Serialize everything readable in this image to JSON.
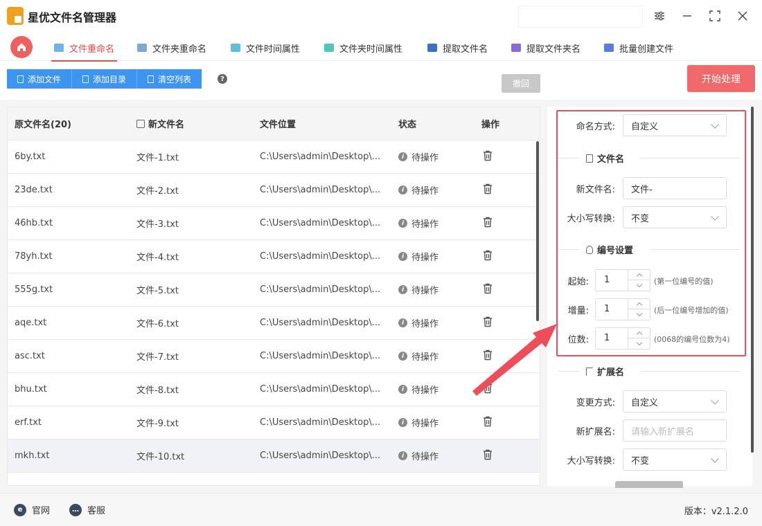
{
  "app": {
    "title": "星优文件名管理器"
  },
  "tabs": [
    {
      "label": "文件重命名",
      "active": true,
      "icon": "folder-icon"
    },
    {
      "label": "文件夹重命名",
      "icon": "folder-icon"
    },
    {
      "label": "文件时间属性",
      "icon": "clock-icon"
    },
    {
      "label": "文件夹时间属性",
      "icon": "clock-icon"
    },
    {
      "label": "提取文件名",
      "icon": "file-icon"
    },
    {
      "label": "提取文件夹名",
      "icon": "file-icon"
    },
    {
      "label": "批量创建文件",
      "icon": "file-icon"
    }
  ],
  "toolbar": {
    "add_file": "添加文件",
    "add_dir": "添加目录",
    "clear_list": "清空列表",
    "undo": "撤回",
    "start": "开始处理"
  },
  "table": {
    "headers": {
      "orig": "原文件名(20)",
      "new": "新文件名",
      "location": "文件位置",
      "status": "状态",
      "action": "操作"
    },
    "rows": [
      {
        "orig": "6by.txt",
        "new": "文件-1.txt",
        "location": "C:\\Users\\admin\\Desktop\\...",
        "status": "待操作"
      },
      {
        "orig": "23de.txt",
        "new": "文件-2.txt",
        "location": "C:\\Users\\admin\\Desktop\\...",
        "status": "待操作"
      },
      {
        "orig": "46hb.txt",
        "new": "文件-3.txt",
        "location": "C:\\Users\\admin\\Desktop\\...",
        "status": "待操作"
      },
      {
        "orig": "78yh.txt",
        "new": "文件-4.txt",
        "location": "C:\\Users\\admin\\Desktop\\...",
        "status": "待操作"
      },
      {
        "orig": "555g.txt",
        "new": "文件-5.txt",
        "location": "C:\\Users\\admin\\Desktop\\...",
        "status": "待操作"
      },
      {
        "orig": "aqe.txt",
        "new": "文件-6.txt",
        "location": "C:\\Users\\admin\\Desktop\\...",
        "status": "待操作"
      },
      {
        "orig": "asc.txt",
        "new": "文件-7.txt",
        "location": "C:\\Users\\admin\\Desktop\\...",
        "status": "待操作"
      },
      {
        "orig": "bhu.txt",
        "new": "文件-8.txt",
        "location": "C:\\Users\\admin\\Desktop\\...",
        "status": "待操作"
      },
      {
        "orig": "erf.txt",
        "new": "文件-9.txt",
        "location": "C:\\Users\\admin\\Desktop\\...",
        "status": "待操作"
      },
      {
        "orig": "mkh.txt",
        "new": "文件-10.txt",
        "location": "C:\\Users\\admin\\Desktop\\...",
        "status": "待操作"
      }
    ]
  },
  "panel": {
    "naming_mode_label": "命名方式:",
    "naming_mode_value": "自定义",
    "filename_section": "文件名",
    "new_name_label": "新文件名:",
    "new_name_value": "文件-",
    "case_label": "大小写转换:",
    "case_value": "不变",
    "numbering_section": "编号设置",
    "start_label": "起始:",
    "start_value": "1",
    "start_hint": "(第一位编号的值)",
    "step_label": "增量:",
    "step_value": "1",
    "step_hint": "(后一位编号增加的值)",
    "digits_label": "位数:",
    "digits_value": "1",
    "digits_hint": "(0068的编号位数为4)",
    "ext_section": "扩展名",
    "ext_mode_label": "变更方式:",
    "ext_mode_value": "自定义",
    "new_ext_label": "新扩展名:",
    "new_ext_placeholder": "请输入新扩展名",
    "ext_case_label": "大小写转换:",
    "ext_case_value": "不变"
  },
  "footer": {
    "website": "官网",
    "service": "客服",
    "version": "版本：v2.1.2.0"
  },
  "colors": {
    "accent": "#e94d4d",
    "primary": "#3d95f0",
    "start": "#f06a6a",
    "highlight_box": "#ee4d5a"
  }
}
